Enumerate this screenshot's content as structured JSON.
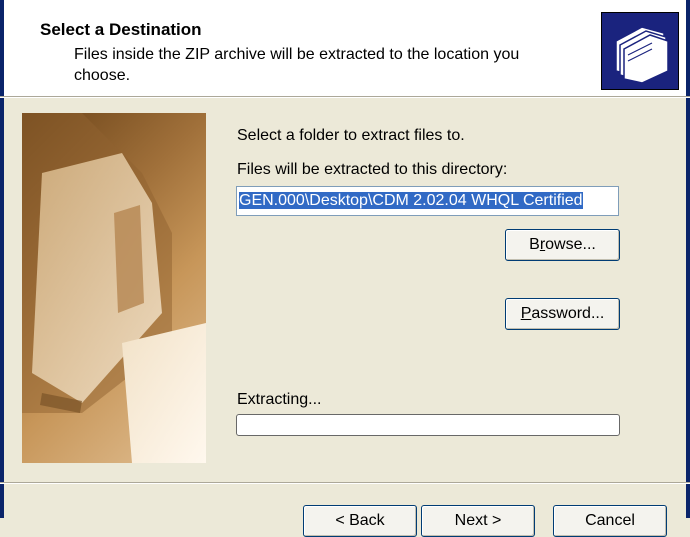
{
  "header": {
    "title": "Select a Destination",
    "subtitle": "Files inside the ZIP archive will be extracted to the location you choose.",
    "icon": "folders-icon"
  },
  "main": {
    "instruction": "Select a folder to extract files to.",
    "directory_label": "Files will be extracted to this directory:",
    "directory_value": "GEN.000\\Desktop\\CDM 2.02.04 WHQL Certified",
    "browse_button": {
      "pre": "B",
      "accel": "r",
      "post": "owse..."
    },
    "password_button": {
      "pre": "",
      "accel": "P",
      "post": "assword..."
    },
    "extracting_label": "Extracting...",
    "progress_fraction": 0
  },
  "footer": {
    "back_label": "< Back",
    "next_label": "Next >",
    "cancel_label": "Cancel"
  },
  "colors": {
    "title_bar": "#0A246A",
    "dialog_bg": "#ECE9D8",
    "selection": "#316AC5",
    "progress_fill": "#2FB73A"
  }
}
